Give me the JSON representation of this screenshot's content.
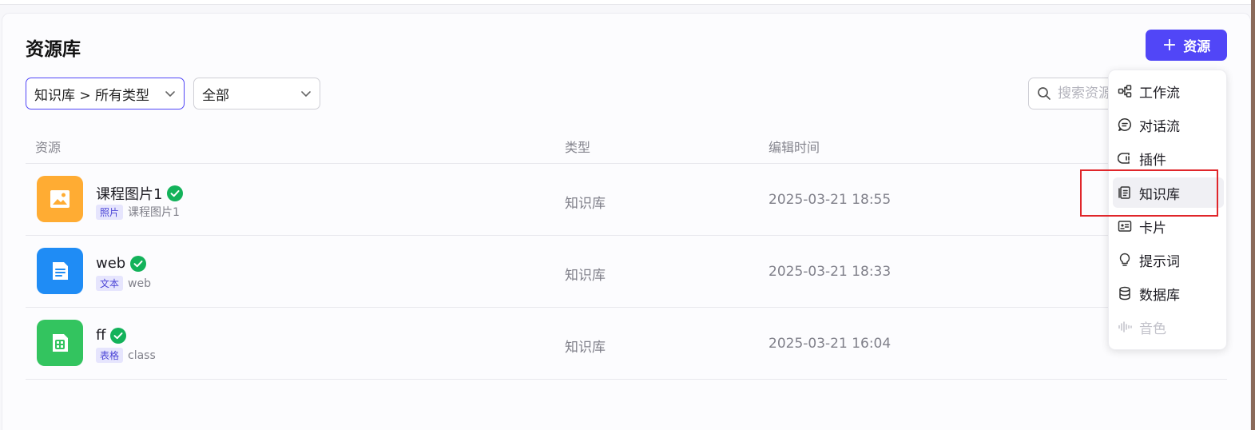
{
  "page": {
    "title": "资源库"
  },
  "toolbar": {
    "add_label": "资源"
  },
  "filters": {
    "scope": "知识库 > 所有类型",
    "status": "全部",
    "search_placeholder": "搜索资源"
  },
  "table": {
    "columns": [
      "资源",
      "类型",
      "编辑时间"
    ],
    "rows": [
      {
        "name": "课程图片1",
        "tag": "照片",
        "desc": "课程图片1",
        "type": "知识库",
        "time": "2025-03-21 18:55",
        "icon": "image-icon",
        "color": "#ffac33"
      },
      {
        "name": "web",
        "tag": "文本",
        "desc": "web",
        "type": "知识库",
        "time": "2025-03-21 18:33",
        "icon": "document-icon",
        "color": "#1f8cf5"
      },
      {
        "name": "ff",
        "tag": "表格",
        "desc": "class",
        "type": "知识库",
        "time": "2025-03-21 16:04",
        "icon": "table-icon",
        "color": "#33c45f"
      }
    ]
  },
  "menu": {
    "items": [
      {
        "label": "工作流",
        "icon": "workflow-icon"
      },
      {
        "label": "对话流",
        "icon": "chat-flow-icon"
      },
      {
        "label": "插件",
        "icon": "plugin-icon"
      },
      {
        "label": "知识库",
        "icon": "knowledge-icon",
        "selected": true
      },
      {
        "label": "卡片",
        "icon": "card-icon"
      },
      {
        "label": "提示词",
        "icon": "prompt-icon"
      },
      {
        "label": "数据库",
        "icon": "database-icon"
      },
      {
        "label": "音色",
        "icon": "voice-icon",
        "disabled": true
      }
    ]
  },
  "colors": {
    "accent": "#5146f7",
    "success": "#13b25a",
    "highlight": "#e0262a"
  }
}
